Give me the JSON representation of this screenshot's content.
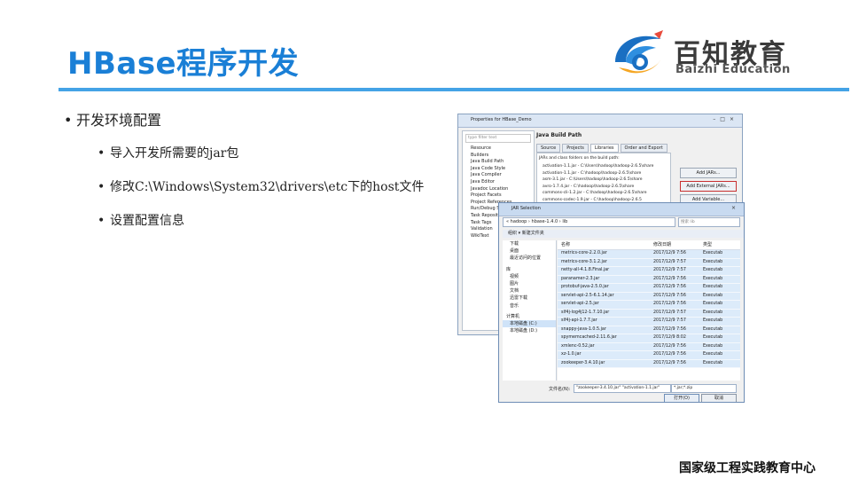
{
  "slide": {
    "title": "HBase程序开发",
    "bullets": [
      "开发环境配置",
      "导入开发所需要的jar包",
      "修改C:\\Windows\\System32\\drivers\\etc下的host文件",
      "设置配置信息"
    ],
    "footer": "国家级工程实践教育中心"
  },
  "logo": {
    "name": "百知教育",
    "subtitle": "Baizhi Education",
    "colors": [
      "#1a6fc2",
      "#f5a623",
      "#e84b3c"
    ]
  },
  "eclipse": {
    "title": "Properties for HBase_Demo",
    "window_buttons": "–□×",
    "filter_placeholder": "type filter text",
    "tree": [
      "Resource",
      "Builders",
      "Java Build Path",
      "Java Code Style",
      "Java Compiler",
      "Java Editor",
      "Javadoc Location",
      "Project Facets",
      "Project References",
      "Run/Debug Settings",
      "Task Repository",
      "Task Tags",
      "Validation",
      "WikiText"
    ],
    "section": "Java Build Path",
    "tabs": [
      "Source",
      "Projects",
      "Libraries",
      "Order and Export"
    ],
    "jar_caption": "JARs and class folders on the build path:",
    "jars": [
      "activation-1.1.jar - C:\\Users\\hadoop\\hadoop-2.6.5\\share",
      "activation-1.1.jar - C:\\hadoop\\hadoop-2.6.5\\share",
      "asm-3.1.jar - C:\\Users\\hadoop\\hadoop-2.6.5\\share",
      "avro-1.7.4.jar - C:\\hadoop\\hadoop-2.6.5\\share",
      "commons-cli-1.2.jar - C:\\hadoop\\hadoop-2.6.5\\share",
      "commons-codec-1.9.jar - C:\\hadoop\\hadoop-2.6.5"
    ],
    "buttons": [
      "Add JARs...",
      "Add External JARs...",
      "Add Variable..."
    ]
  },
  "jar_dialog": {
    "title": "JAR Selection",
    "path": "« hadoop › hbase-1.4.0 › lib",
    "search_placeholder": "搜索 lib",
    "toolbar": "组织 ▾   新建文件夹",
    "nav": [
      {
        "label": "下载",
        "group": false
      },
      {
        "label": "桌面",
        "group": false
      },
      {
        "label": "最近访问的位置",
        "group": false
      },
      {
        "label": "库",
        "group": true
      },
      {
        "label": "视频",
        "group": false
      },
      {
        "label": "图片",
        "group": false
      },
      {
        "label": "文档",
        "group": false
      },
      {
        "label": "迅雷下载",
        "group": false
      },
      {
        "label": "音乐",
        "group": false
      },
      {
        "label": "计算机",
        "group": true
      },
      {
        "label": "本地磁盘 (C:)",
        "group": false
      },
      {
        "label": "本地磁盘 (D:)",
        "group": false
      }
    ],
    "columns": [
      "名称",
      "修改日期",
      "类型"
    ],
    "files": [
      {
        "name": "metrics-core-2.2.0.jar",
        "date": "2017/12/9 7:56",
        "type": "Executab"
      },
      {
        "name": "metrics-core-3.1.2.jar",
        "date": "2017/12/9 7:57",
        "type": "Executab"
      },
      {
        "name": "netty-all-4.1.8.Final.jar",
        "date": "2017/12/9 7:57",
        "type": "Executab"
      },
      {
        "name": "paranamer-2.3.jar",
        "date": "2017/12/9 7:56",
        "type": "Executab"
      },
      {
        "name": "protobuf-java-2.5.0.jar",
        "date": "2017/12/9 7:56",
        "type": "Executab"
      },
      {
        "name": "servlet-api-2.5-6.1.14.jar",
        "date": "2017/12/9 7:56",
        "type": "Executab"
      },
      {
        "name": "servlet-api-2.5.jar",
        "date": "2017/12/9 7:56",
        "type": "Executab"
      },
      {
        "name": "slf4j-log4j12-1.7.10.jar",
        "date": "2017/12/9 7:57",
        "type": "Executab"
      },
      {
        "name": "slf4j-api-1.7.7.jar",
        "date": "2017/12/9 7:57",
        "type": "Executab"
      },
      {
        "name": "snappy-java-1.0.5.jar",
        "date": "2017/12/9 7:56",
        "type": "Executab"
      },
      {
        "name": "spymemcached-2.11.6.jar",
        "date": "2017/12/9 8:02",
        "type": "Executab"
      },
      {
        "name": "xmlenc-0.52.jar",
        "date": "2017/12/9 7:56",
        "type": "Executab"
      },
      {
        "name": "xz-1.0.jar",
        "date": "2017/12/9 7:56",
        "type": "Executab"
      },
      {
        "name": "zookeeper-3.4.10.jar",
        "date": "2017/12/9 7:56",
        "type": "Executab"
      }
    ],
    "filename_label": "文件名(N):",
    "filename_value": "\"zookeeper-3.4.10.jar\" \"activation-1.1.jar\"",
    "filetype": "*.jar;*.zip",
    "open": "打开(O)",
    "cancel": "取消"
  }
}
